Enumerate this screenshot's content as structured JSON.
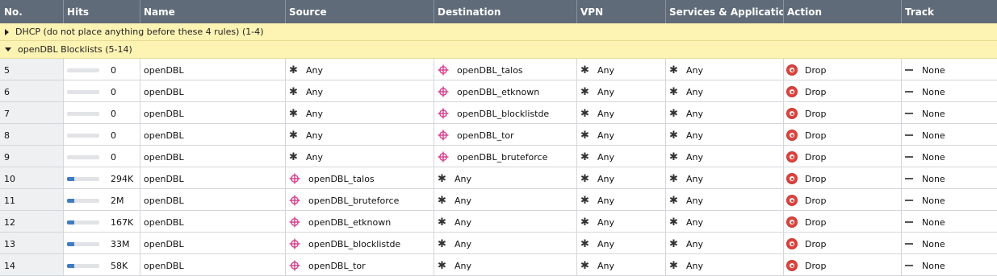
{
  "columns": [
    "No.",
    "Hits",
    "Name",
    "Source",
    "Destination",
    "VPN",
    "Services & Applications",
    "Action",
    "Track"
  ],
  "sections": [
    {
      "label": "DHCP (do not place anything before these 4 rules)",
      "range": "(1-4)",
      "expanded": false
    },
    {
      "label": "openDBL Blocklists",
      "range": "(5-14)",
      "expanded": true
    }
  ],
  "rules": [
    {
      "no": "5",
      "hits": "0",
      "hits_fill": 0,
      "name": "openDBL",
      "source": "Any",
      "destination": "openDBL_talos",
      "vpn": "Any",
      "services": "Any",
      "action": "Drop",
      "track": "None"
    },
    {
      "no": "6",
      "hits": "0",
      "hits_fill": 0,
      "name": "openDBL",
      "source": "Any",
      "destination": "openDBL_etknown",
      "vpn": "Any",
      "services": "Any",
      "action": "Drop",
      "track": "None"
    },
    {
      "no": "7",
      "hits": "0",
      "hits_fill": 0,
      "name": "openDBL",
      "source": "Any",
      "destination": "openDBL_blocklistde",
      "vpn": "Any",
      "services": "Any",
      "action": "Drop",
      "track": "None"
    },
    {
      "no": "8",
      "hits": "0",
      "hits_fill": 0,
      "name": "openDBL",
      "source": "Any",
      "destination": "openDBL_tor",
      "vpn": "Any",
      "services": "Any",
      "action": "Drop",
      "track": "None"
    },
    {
      "no": "9",
      "hits": "0",
      "hits_fill": 0,
      "name": "openDBL",
      "source": "Any",
      "destination": "openDBL_bruteforce",
      "vpn": "Any",
      "services": "Any",
      "action": "Drop",
      "track": "None"
    },
    {
      "no": "10",
      "hits": "294K",
      "hits_fill": 0.22,
      "name": "openDBL",
      "source": "openDBL_talos",
      "destination": "Any",
      "vpn": "Any",
      "services": "Any",
      "action": "Drop",
      "track": "None"
    },
    {
      "no": "11",
      "hits": "2M",
      "hits_fill": 0.22,
      "name": "openDBL",
      "source": "openDBL_bruteforce",
      "destination": "Any",
      "vpn": "Any",
      "services": "Any",
      "action": "Drop",
      "track": "None"
    },
    {
      "no": "12",
      "hits": "167K",
      "hits_fill": 0.22,
      "name": "openDBL",
      "source": "openDBL_etknown",
      "destination": "Any",
      "vpn": "Any",
      "services": "Any",
      "action": "Drop",
      "track": "None"
    },
    {
      "no": "13",
      "hits": "33M",
      "hits_fill": 0.22,
      "name": "openDBL",
      "source": "openDBL_blocklistde",
      "destination": "Any",
      "vpn": "Any",
      "services": "Any",
      "action": "Drop",
      "track": "None"
    },
    {
      "no": "14",
      "hits": "58K",
      "hits_fill": 0.22,
      "name": "openDBL",
      "source": "openDBL_tor",
      "destination": "Any",
      "vpn": "Any",
      "services": "Any",
      "action": "Drop",
      "track": "None"
    }
  ],
  "colors": {
    "header_bg": "#5f6b78",
    "section_bg": "#fdf3b3",
    "hit_bar": "#3f7cc0",
    "drop": "#e0423e",
    "network_object": "#d63c8a"
  }
}
